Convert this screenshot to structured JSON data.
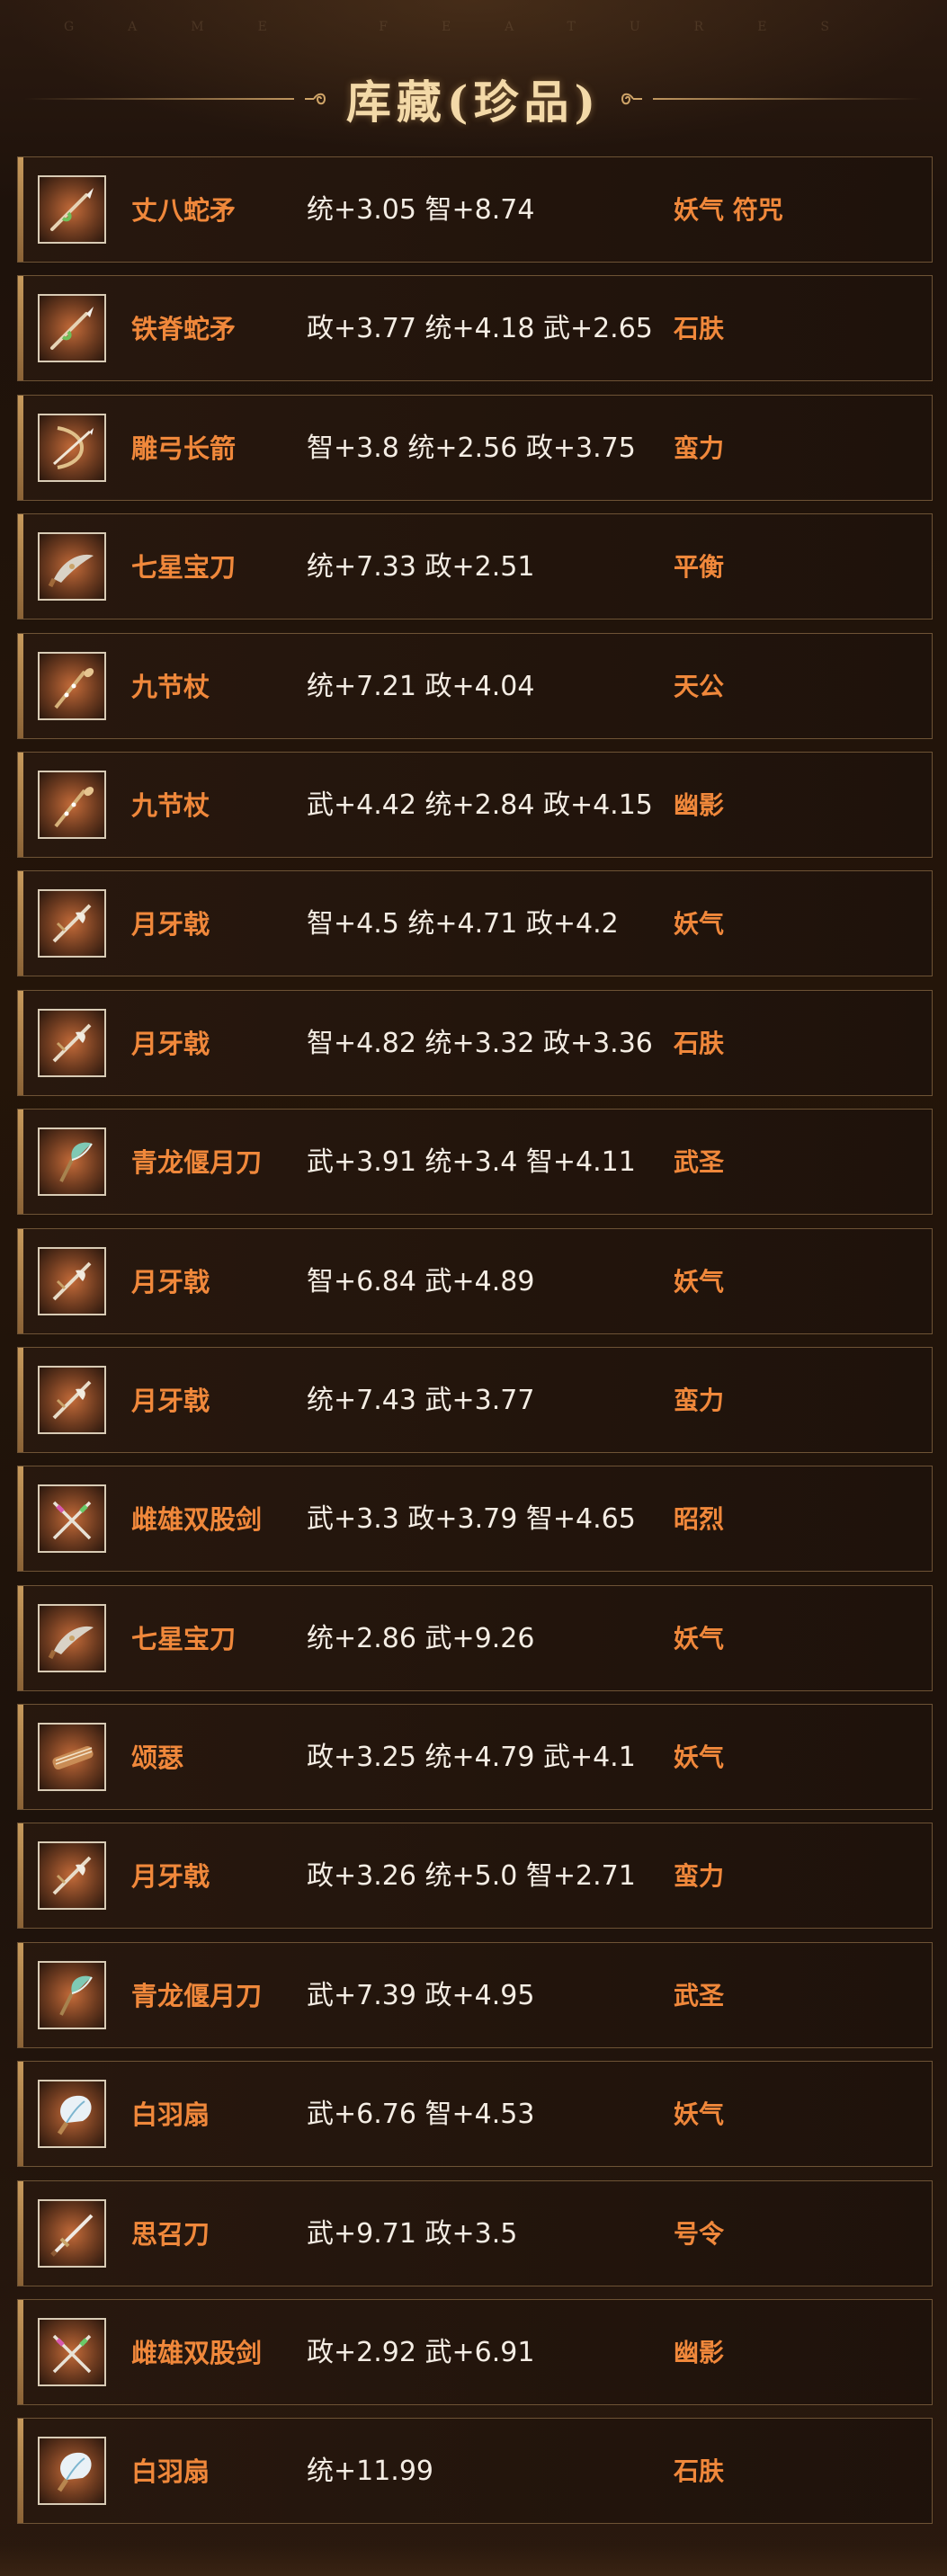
{
  "header": {
    "watermark": "GAME FEATURES",
    "title": "库藏(珍品)"
  },
  "items": [
    {
      "name": "丈八蛇矛",
      "stats": "统+3.05 智+8.74",
      "trait": "妖气 符咒",
      "icon": "spear-icon"
    },
    {
      "name": "铁脊蛇矛",
      "stats": "政+3.77 统+4.18 武+2.65",
      "trait": "石肤",
      "icon": "spear-icon"
    },
    {
      "name": "雕弓长箭",
      "stats": "智+3.8 统+2.56 政+3.75",
      "trait": "蛮力",
      "icon": "bow-icon"
    },
    {
      "name": "七星宝刀",
      "stats": "统+7.33 政+2.51",
      "trait": "平衡",
      "icon": "blade-icon"
    },
    {
      "name": "九节杖",
      "stats": "统+7.21 政+4.04",
      "trait": "天公",
      "icon": "staff-icon"
    },
    {
      "name": "九节杖",
      "stats": "武+4.42 统+2.84 政+4.15",
      "trait": "幽影",
      "icon": "staff-icon"
    },
    {
      "name": "月牙戟",
      "stats": "智+4.5 统+4.71 政+4.2",
      "trait": "妖气",
      "icon": "halberd-icon"
    },
    {
      "name": "月牙戟",
      "stats": "智+4.82 统+3.32 政+3.36",
      "trait": "石肤",
      "icon": "halberd-icon"
    },
    {
      "name": "青龙偃月刀",
      "stats": "武+3.91 统+3.4 智+4.11",
      "trait": "武圣",
      "icon": "glaive-icon"
    },
    {
      "name": "月牙戟",
      "stats": "智+6.84 武+4.89",
      "trait": "妖气",
      "icon": "halberd-icon"
    },
    {
      "name": "月牙戟",
      "stats": "统+7.43 武+3.77",
      "trait": "蛮力",
      "icon": "halberd-icon"
    },
    {
      "name": "雌雄双股剑",
      "stats": "武+3.3 政+3.79 智+4.65",
      "trait": "昭烈",
      "icon": "twin-swords-icon"
    },
    {
      "name": "七星宝刀",
      "stats": "统+2.86 武+9.26",
      "trait": "妖气",
      "icon": "blade-icon"
    },
    {
      "name": "颂瑟",
      "stats": "政+3.25 统+4.79 武+4.1",
      "trait": "妖气",
      "icon": "zither-icon"
    },
    {
      "name": "月牙戟",
      "stats": "政+3.26 统+5.0 智+2.71",
      "trait": "蛮力",
      "icon": "halberd-icon"
    },
    {
      "name": "青龙偃月刀",
      "stats": "武+7.39 政+4.95",
      "trait": "武圣",
      "icon": "glaive-icon"
    },
    {
      "name": "白羽扇",
      "stats": "武+6.76 智+4.53",
      "trait": "妖气",
      "icon": "feather-fan-icon"
    },
    {
      "name": "思召刀",
      "stats": "武+9.71 政+3.5",
      "trait": "号令",
      "icon": "sword-icon"
    },
    {
      "name": "雌雄双股剑",
      "stats": "政+2.92 武+6.91",
      "trait": "幽影",
      "icon": "twin-swords-icon"
    },
    {
      "name": "白羽扇",
      "stats": "统+11.99",
      "trait": "石肤",
      "icon": "feather-fan-icon"
    }
  ]
}
